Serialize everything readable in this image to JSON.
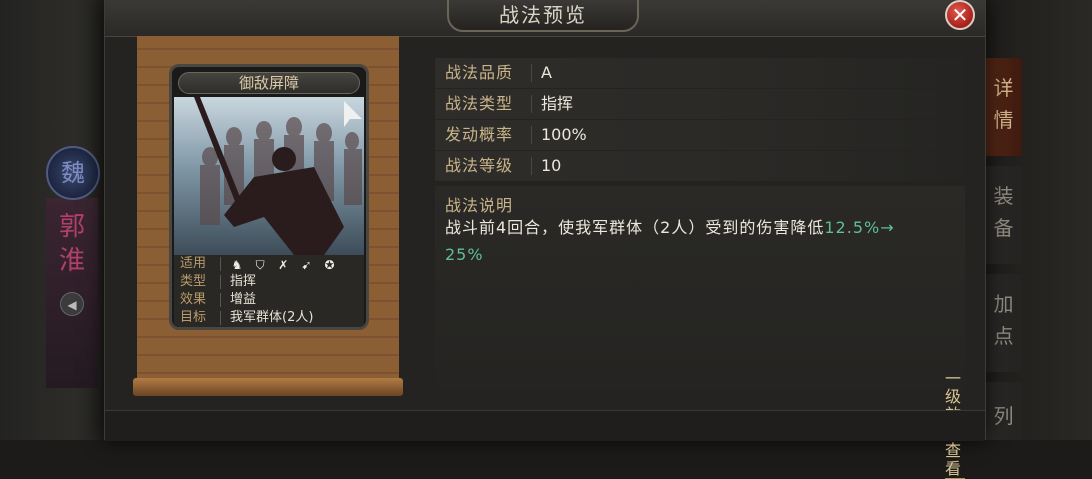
{
  "window": {
    "title": "战法预览",
    "close_symbol": "✕"
  },
  "hero": {
    "emblem_char": "魏",
    "name": "郭淮",
    "voice_icon": "speaker-icon"
  },
  "side_tabs": [
    {
      "label": "详情",
      "active": true
    },
    {
      "label": "装备",
      "active": false
    },
    {
      "label": "加点",
      "active": false
    },
    {
      "label": "列",
      "active": false
    }
  ],
  "card": {
    "name": "御敌屏障",
    "stats": [
      {
        "key": "适用",
        "value": ""
      },
      {
        "key": "类型",
        "value": "指挥"
      },
      {
        "key": "效果",
        "value": "增益"
      },
      {
        "key": "目标",
        "value": "我军群体(2人)"
      }
    ],
    "troop_icons": [
      "cavalry-icon",
      "shield-icon",
      "bow-icon",
      "spear-icon",
      "siege-icon"
    ]
  },
  "info": [
    {
      "key": "战法品质",
      "value": "A"
    },
    {
      "key": "战法类型",
      "value": "指挥"
    },
    {
      "key": "发动概率",
      "value": "100%"
    },
    {
      "key": "战法等级",
      "value": "10"
    }
  ],
  "description": {
    "title": "战法说明",
    "text_main": "战斗前4回合，使我军群体（2人）受到的伤害降低",
    "text_highlight_1": "12.5%→",
    "text_highlight_2": "25%"
  },
  "level_link": "一级效果查看",
  "colors": {
    "accent_gold": "#c9b48a",
    "highlight_green": "#5fbf9a",
    "close_red": "#b52822"
  }
}
